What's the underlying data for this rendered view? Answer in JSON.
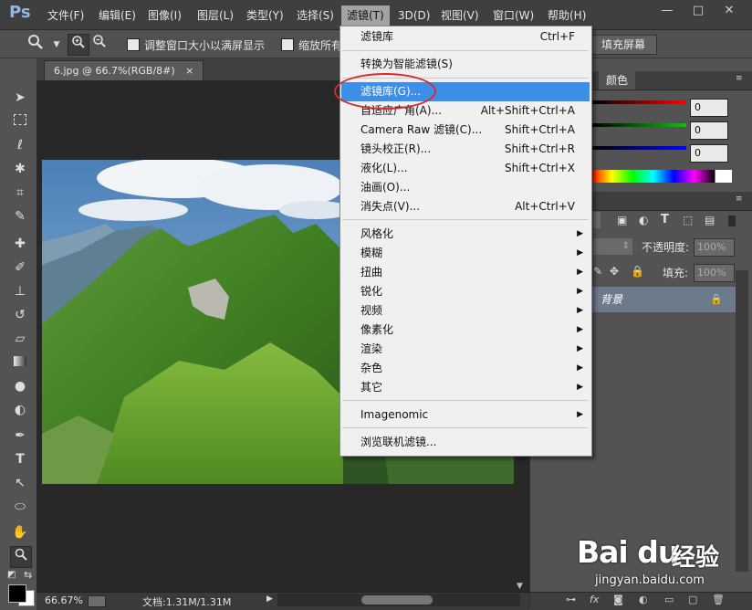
{
  "app": {
    "logo": "Ps"
  },
  "menubar": {
    "items": [
      "文件(F)",
      "编辑(E)",
      "图像(I)",
      "图层(L)",
      "类型(Y)",
      "选择(S)",
      "滤镜(T)",
      "3D(D)",
      "视图(V)",
      "窗口(W)",
      "帮助(H)"
    ],
    "active": "滤镜(T)"
  },
  "window_controls": {
    "minimize": "—",
    "restore": "□",
    "close": "✕"
  },
  "options_bar": {
    "resize_windows_label": "调整窗口大小以满屏显示",
    "zoom_all_label": "缩放所有",
    "fill_screen_button": "填充屏幕"
  },
  "document": {
    "tab_title": "6.jpg @ 66.7%(RGB/8#)",
    "tab_close": "×"
  },
  "status_bar": {
    "zoom": "66.67%",
    "doc_info": "文档:1.31M/1.31M"
  },
  "color_panel": {
    "tab_label": "颜色",
    "r": "0",
    "g": "0",
    "b": "0"
  },
  "layers_panel": {
    "opacity_label": "不透明度:",
    "opacity_value": "100%",
    "fill_label": "填充:",
    "fill_value": "100%",
    "layer_name": "背景"
  },
  "filter_menu": {
    "top_item": {
      "label": "滤镜库",
      "shortcut": "Ctrl+F"
    },
    "convert_smart": "转换为智能滤镜(S)",
    "group1": [
      {
        "label": "滤镜库(G)...",
        "shortcut": "",
        "highlighted": true
      },
      {
        "label": "自适应广角(A)...",
        "shortcut": "Alt+Shift+Ctrl+A"
      },
      {
        "label": "Camera Raw 滤镜(C)...",
        "shortcut": "Shift+Ctrl+A"
      },
      {
        "label": "镜头校正(R)...",
        "shortcut": "Shift+Ctrl+R"
      },
      {
        "label": "液化(L)...",
        "shortcut": "Shift+Ctrl+X"
      },
      {
        "label": "油画(O)...",
        "shortcut": ""
      },
      {
        "label": "消失点(V)...",
        "shortcut": "Alt+Ctrl+V"
      }
    ],
    "submenus": [
      "风格化",
      "模糊",
      "扭曲",
      "锐化",
      "视频",
      "像素化",
      "渲染",
      "杂色",
      "其它"
    ],
    "imagenomic": "Imagenomic",
    "browse_online": "浏览联机滤镜..."
  },
  "watermark": {
    "logo": "Bai du",
    "brand": "经验",
    "url": "jingyan.baidu.com"
  },
  "colors": {
    "highlight": "#3d8ee6",
    "annotation_circle": "#d62c2c"
  }
}
